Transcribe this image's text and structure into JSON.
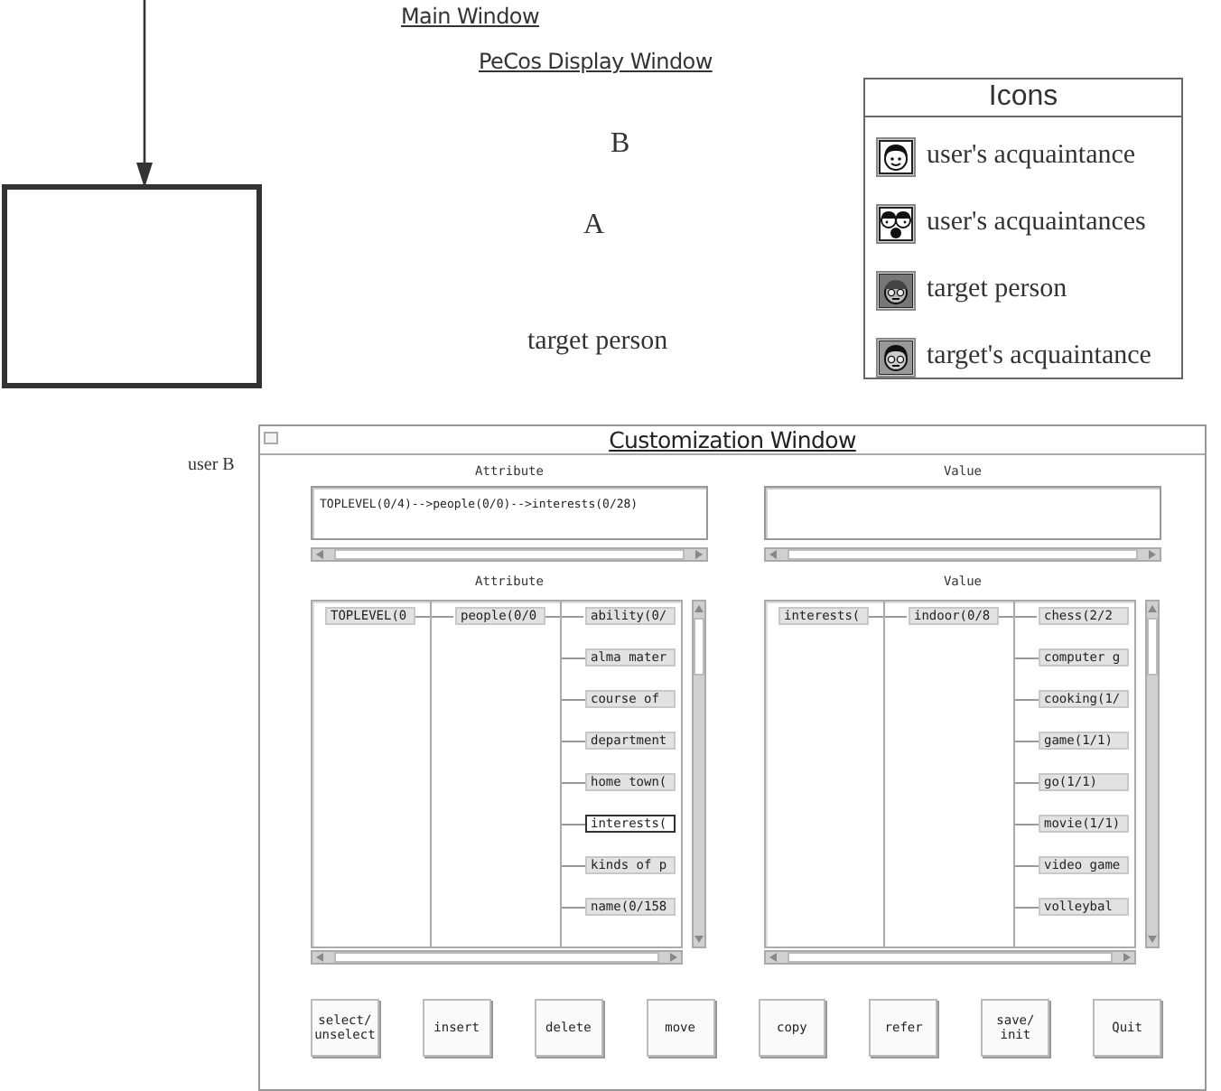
{
  "main_window_label": "Main Window",
  "display_window_label": "PeCos Display Window",
  "display_labels": [
    "B",
    "A",
    "target person"
  ],
  "legend": {
    "title": "Icons",
    "items": [
      {
        "kind": "plain",
        "label": "user's acquaintance"
      },
      {
        "kind": "group",
        "label": "user's acquaintances"
      },
      {
        "kind": "glasses",
        "label": "target person"
      },
      {
        "kind": "glasses-hair",
        "label": "target's acquaintance"
      }
    ]
  },
  "user_label": "user B",
  "customization_window": {
    "title": "Customization Window",
    "path_fields": [
      {
        "heading": "Attribute",
        "value": "TOPLEVEL(0/4)-->people(0/0)-->interests(0/28)"
      },
      {
        "heading": "Value"
      }
    ],
    "trees": [
      {
        "heading": "Attribute",
        "nodes": [
          {
            "label": "TOPLEVEL(0",
            "selected": false,
            "children": [
              {
                "label": "people(0/0",
                "selected": false,
                "children": [
                  {
                    "label": "ability(0/",
                    "selected": false
                  },
                  {
                    "label": "alma mater",
                    "selected": false
                  },
                  {
                    "label": "course of",
                    "selected": false
                  },
                  {
                    "label": "department",
                    "selected": false
                  },
                  {
                    "label": "home town(",
                    "selected": false
                  },
                  {
                    "label": "interests(",
                    "selected": true
                  },
                  {
                    "label": "kinds of p",
                    "selected": false
                  },
                  {
                    "label": "name(0/158",
                    "selected": false
                  }
                ]
              }
            ]
          }
        ]
      },
      {
        "heading": "Value",
        "nodes": [
          {
            "label": "interests(",
            "selected": false,
            "children": [
              {
                "label": "indoor(0/8",
                "selected": false,
                "children": [
                  {
                    "label": "chess(2/2",
                    "selected": false
                  },
                  {
                    "label": "computer g",
                    "selected": false
                  },
                  {
                    "label": "cooking(1/",
                    "selected": false
                  },
                  {
                    "label": "game(1/1)",
                    "selected": false
                  },
                  {
                    "label": "go(1/1)",
                    "selected": false
                  },
                  {
                    "label": "movie(1/1)",
                    "selected": false
                  },
                  {
                    "label": "video game",
                    "selected": false
                  },
                  {
                    "label": "volleybal",
                    "selected": false
                  }
                ]
              }
            ]
          }
        ]
      }
    ],
    "buttons": [
      "select/\nunselect",
      "insert",
      "delete",
      "move",
      "copy",
      "refer",
      "save/\ninit",
      "Quit"
    ]
  }
}
